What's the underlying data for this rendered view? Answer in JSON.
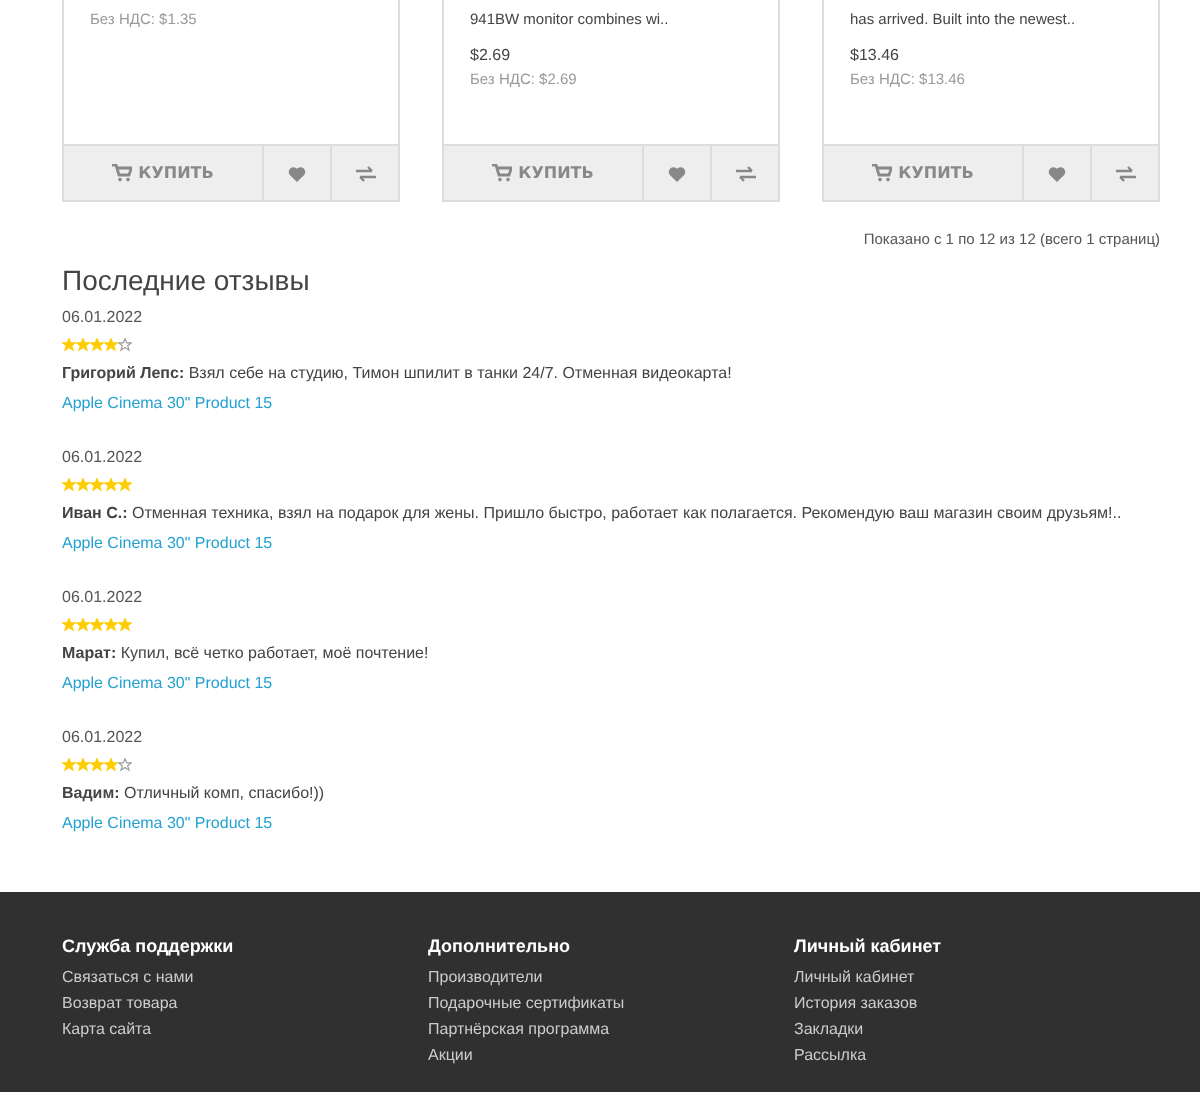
{
  "products": [
    {
      "price_ex_tax": "Без НДС: $1.35",
      "buy_label": "КУПИТЬ"
    },
    {
      "description": "941BW monitor combines wi..",
      "price": "$2.69",
      "price_ex_tax": "Без НДС: $2.69",
      "buy_label": "КУПИТЬ"
    },
    {
      "description": "has arrived. Built into the newest..",
      "price": "$13.46",
      "price_ex_tax": "Без НДС: $13.46",
      "buy_label": "КУПИТЬ"
    }
  ],
  "pagination_info": "Показано с 1 по 12 из 12 (всего 1 страниц)",
  "reviews_title": "Последние отзывы",
  "reviews": [
    {
      "date": "06.01.2022",
      "stars": 4,
      "author": "Григорий Лепс:",
      "text": "Взял себе на студию, Тимон шпилит в танки 24/7. Отменная видеокарта!",
      "product": "Apple Cinema 30\" Product 15"
    },
    {
      "date": "06.01.2022",
      "stars": 5,
      "author": "Иван С.:",
      "text": "Отменная техника, взял на подарок для жены. Пришло быстро, работает как полагается. Рекомендую ваш магазин своим друзьям!..",
      "product": "Apple Cinema 30\" Product 15"
    },
    {
      "date": "06.01.2022",
      "stars": 5,
      "author": "Марат:",
      "text": "Купил, всё четко работает, моё почтение!",
      "product": "Apple Cinema 30\" Product 15"
    },
    {
      "date": "06.01.2022",
      "stars": 4,
      "author": "Вадим:",
      "text": "Отличный комп, спасибо!))",
      "product": "Apple Cinema 30\" Product 15"
    }
  ],
  "footer": [
    {
      "title": "Служба поддержки",
      "links": [
        "Связаться с нами",
        "Возврат товара",
        "Карта сайта"
      ]
    },
    {
      "title": "Дополнительно",
      "links": [
        "Производители",
        "Подарочные сертификаты",
        "Партнёрская программа",
        "Акции"
      ]
    },
    {
      "title": "Личный кабинет",
      "links": [
        "Личный кабинет",
        "История заказов",
        "Закладки",
        "Рассылка"
      ]
    }
  ]
}
